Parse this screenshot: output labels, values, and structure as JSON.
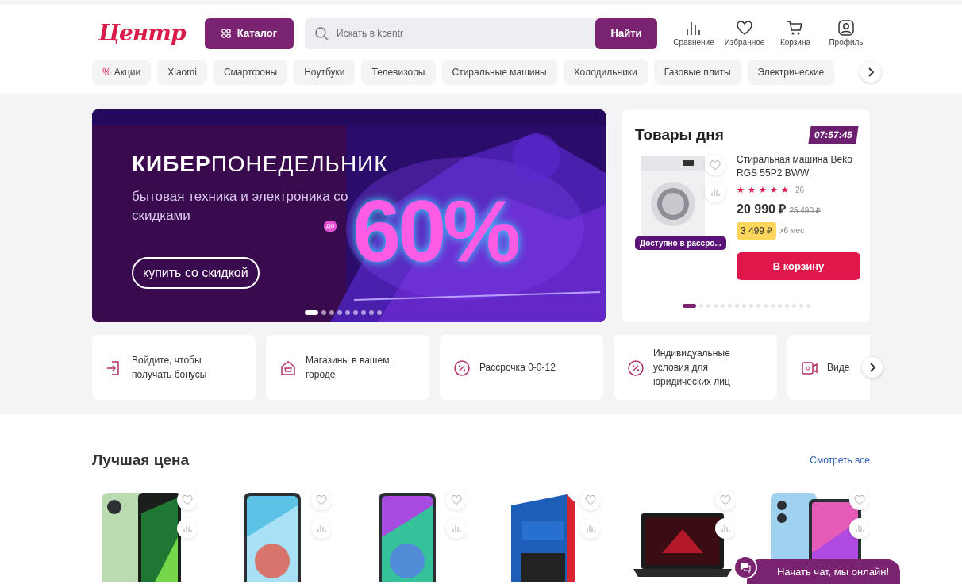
{
  "header": {
    "logo": "Центр",
    "catalog_button": "Каталог",
    "search": {
      "placeholder": "Искать в kcentr",
      "button": "Найти"
    },
    "actions": [
      {
        "kind": "compare",
        "label": "Сравнение"
      },
      {
        "kind": "favorite",
        "label": "Избранное"
      },
      {
        "kind": "cart",
        "label": "Корзина"
      },
      {
        "kind": "profile",
        "label": "Профиль"
      }
    ]
  },
  "categories": [
    {
      "icon": "%",
      "label": "Акции"
    },
    {
      "label": "Xiaomi"
    },
    {
      "label": "Смартфоны"
    },
    {
      "label": "Ноутбуки"
    },
    {
      "label": "Телевизоры"
    },
    {
      "label": "Стиральные машины"
    },
    {
      "label": "Холодильники"
    },
    {
      "label": "Газовые плиты"
    },
    {
      "label": "Электрические"
    }
  ],
  "banner": {
    "title": "**КИБЕР**ПОНЕДЕЛЬНИК",
    "subtitle": "бытовая техника и электроника со скидками",
    "prefix": "до",
    "discount": "60%",
    "button": "купить со скидкой",
    "dots": [
      {
        "selected": true
      },
      {
        "selected": false
      },
      {
        "selected": false
      },
      {
        "selected": false
      },
      {
        "selected": false
      },
      {
        "selected": false
      },
      {
        "selected": false
      },
      {
        "selected": false
      },
      {
        "selected": false
      }
    ]
  },
  "deal_of_day": {
    "title": "Товары дня",
    "timer": "07:57:45",
    "product": {
      "name": "Стиральная машина Beko RGS 55P2 BWW",
      "stars": 5,
      "reviews": "26",
      "price": "20 990 ₽",
      "old_price": "25 490 ₽",
      "installment": "3 499 ₽",
      "installment_term": "x6 мес",
      "badge": "Доступно в рассро...",
      "button": "В корзину"
    },
    "dots": [
      {
        "selected": true
      },
      {
        "selected": false
      },
      {
        "selected": false
      },
      {
        "selected": false
      },
      {
        "selected": false
      },
      {
        "selected": false
      },
      {
        "selected": false
      },
      {
        "selected": false
      },
      {
        "selected": false
      },
      {
        "selected": false
      },
      {
        "selected": false
      },
      {
        "selected": false
      },
      {
        "selected": false
      },
      {
        "selected": false
      },
      {
        "selected": false
      },
      {
        "selected": false
      },
      {
        "selected": false
      }
    ]
  },
  "features": [
    {
      "kind": "login",
      "text": "Войдите, чтобы получать бонусы"
    },
    {
      "kind": "store",
      "text": "Магазины в вашем городе"
    },
    {
      "kind": "percent",
      "text": "Рассрочка 0-0-12"
    },
    {
      "kind": "legal",
      "text": "Индивидуальные условия для юридических лиц"
    },
    {
      "kind": "video",
      "text": "Виде"
    }
  ],
  "best_price": {
    "title": "Лучшая цена",
    "link": "Смотреть все",
    "products": [
      {
        "kind": "phone-green"
      },
      {
        "kind": "phone-blue"
      },
      {
        "kind": "phone-purple"
      },
      {
        "kind": "filter-box"
      },
      {
        "kind": "laptop"
      },
      {
        "kind": "phone-pink"
      }
    ]
  },
  "chat": {
    "label": "Начать чат, мы онлайн!"
  }
}
